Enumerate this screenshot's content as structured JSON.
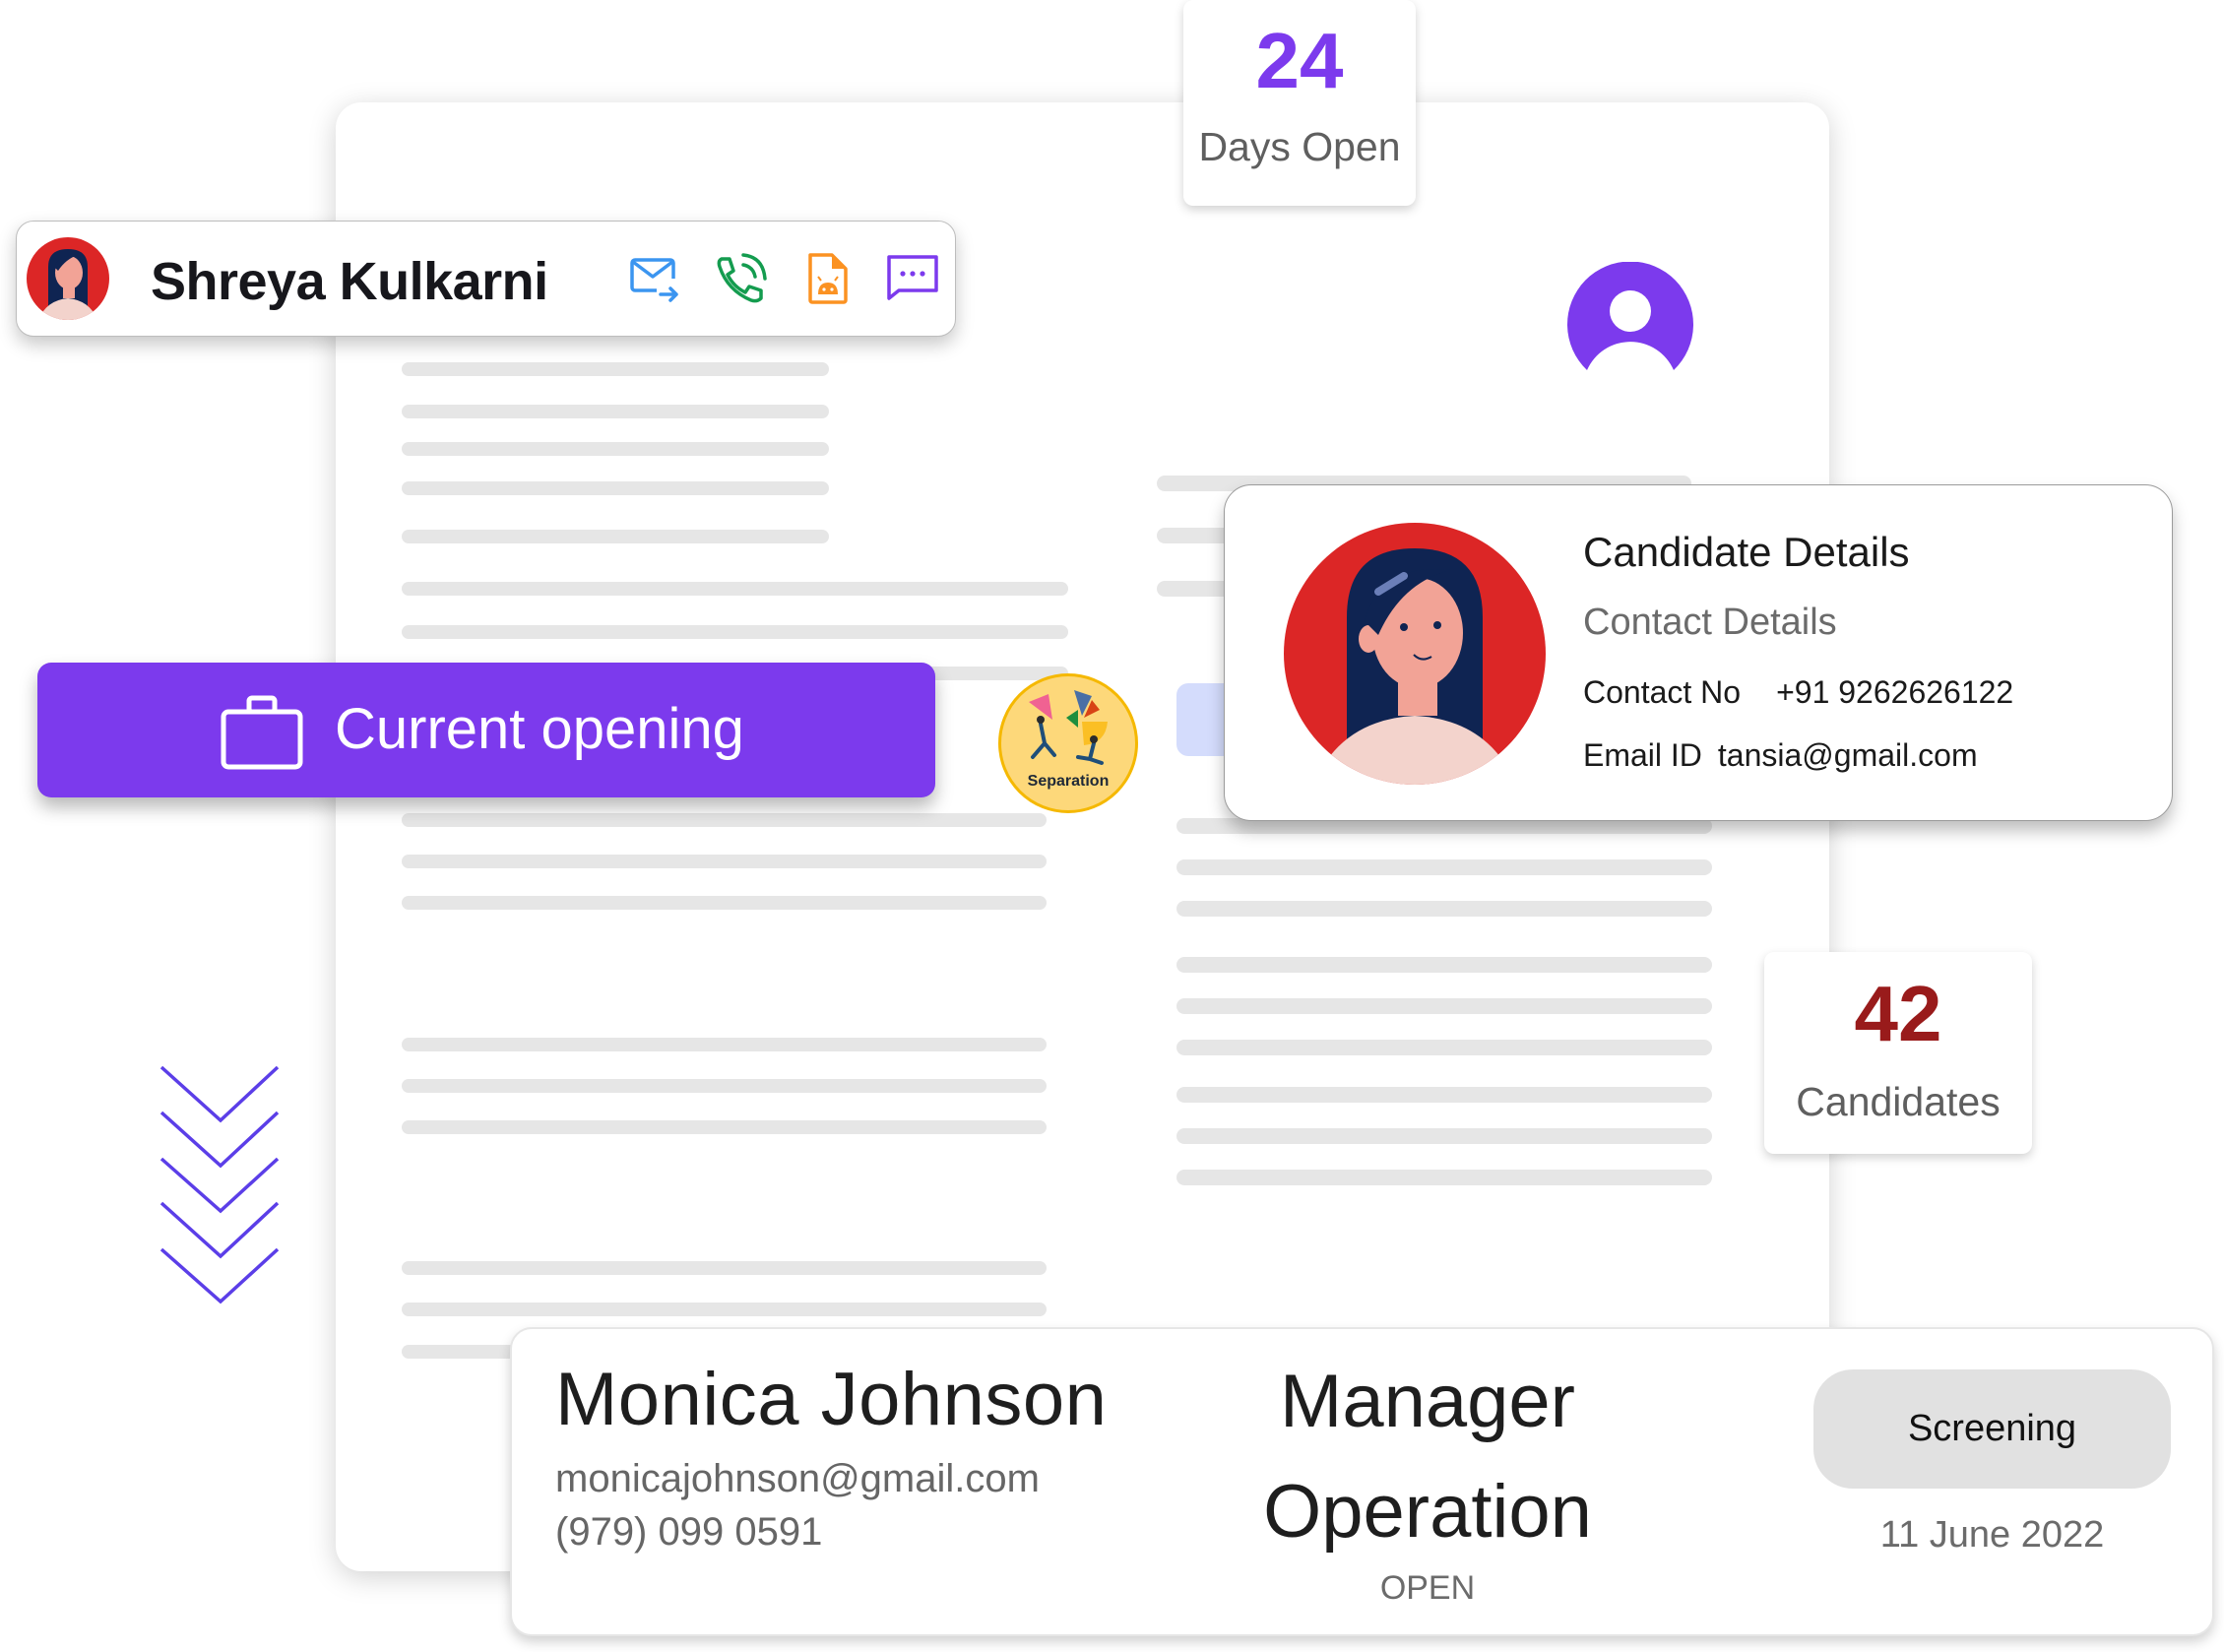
{
  "shreya_card": {
    "name": "Shreya Kulkarni",
    "icons": [
      "mail-forward-icon",
      "phone-call-icon",
      "android-file-icon",
      "chat-icon"
    ],
    "colors": {
      "mail": "#3b95f0",
      "phone": "#149c4f",
      "file": "#fb9222",
      "chat": "#7c3aed"
    }
  },
  "days_open": {
    "value": "24",
    "label": "Days Open",
    "color": "#7c3aed"
  },
  "candidates_stat": {
    "value": "42",
    "label": "Candidates",
    "color": "#991b1b"
  },
  "current_opening": {
    "label": "Current opening",
    "color": "#7c3aed"
  },
  "separation_badge": {
    "label": "Separation"
  },
  "candidate_details": {
    "title": "Candidate Details",
    "subtitle": "Contact Details",
    "contact_label": "Contact No",
    "contact_value": "+91 9262626122",
    "email_label": "Email ID",
    "email_value": "tansia@gmail.com"
  },
  "applicant": {
    "name": "Monica Johnson",
    "email": "monicajohnson@gmail.com",
    "phone": "(979) 099 0591",
    "role_line1": "Manager",
    "role_line2": "Operation",
    "role_status": "OPEN",
    "stage": "Screening",
    "date": "11 June 2022"
  },
  "accent": "#7c3aed"
}
